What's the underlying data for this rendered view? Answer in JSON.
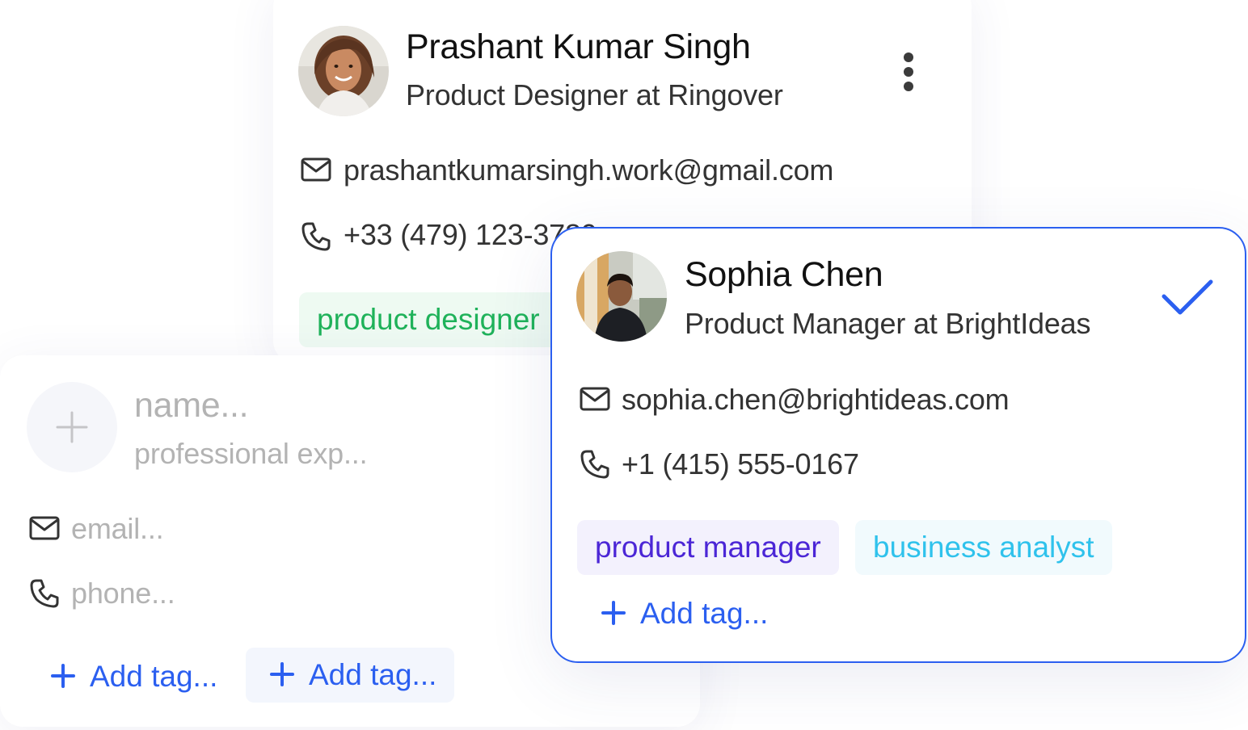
{
  "colors": {
    "accent": "#2b5ff0",
    "tag_green_text": "#1fb25a",
    "tag_green_bg": "#eefaf2",
    "tag_purple_text": "#4b26d6",
    "tag_purple_bg": "#f3f1fd",
    "tag_cyan_text": "#2fc2ec",
    "tag_cyan_bg": "#f1fafd"
  },
  "card_prashant": {
    "name": "Prashant Kumar Singh",
    "role": "Product Designer at Ringover",
    "email": "prashantkumarsingh.work@gmail.com",
    "phone": "+33 (479) 123-3789",
    "tags": [
      "product designer"
    ],
    "menu_icon": "more-vertical-icon"
  },
  "card_empty": {
    "name_placeholder": "name...",
    "role_placeholder": "professional exp...",
    "email_placeholder": "email...",
    "phone_placeholder": "phone...",
    "add_tag_labels": [
      "Add tag...",
      "Add tag..."
    ]
  },
  "card_sophia": {
    "name": "Sophia Chen",
    "role": "Product Manager at BrightIdeas",
    "email": "sophia.chen@brightideas.com",
    "phone": "+1 (415) 555-0167",
    "tags": [
      "product manager",
      "business analyst"
    ],
    "add_tag_label": "Add tag...",
    "selected_icon": "checkmark-icon"
  }
}
